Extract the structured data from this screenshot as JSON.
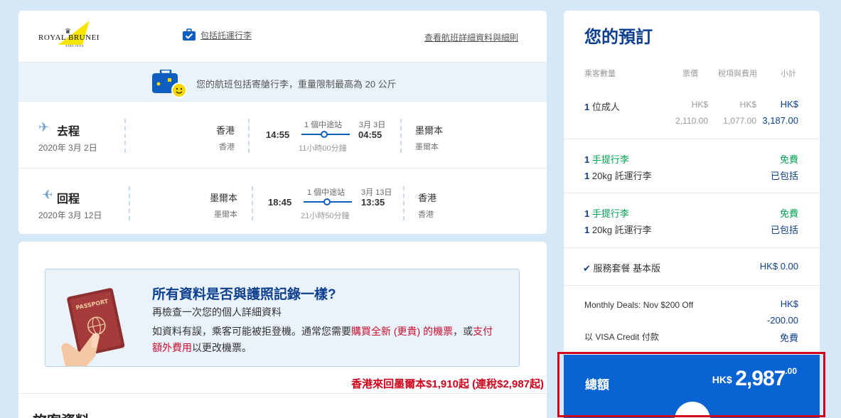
{
  "airline": {
    "name_line1": "ROYAL BRUNEI",
    "name_line2": "AIRLINES"
  },
  "flight_links": {
    "baggage_included": "包括託運行李",
    "details": "查看航班詳細資料與細則"
  },
  "baggage_banner": "您的航班包括寄艙行李，重量限制最高為 20 公斤",
  "outbound": {
    "title": "去程",
    "date": "2020年 3月 2日",
    "from_city": "香港",
    "from_city_sub": "香港",
    "dep_time": "14:55",
    "stops": "1 個中途站",
    "arr_date": "3月 3日",
    "arr_time": "04:55",
    "duration": "11小時00分鐘",
    "to_city": "墨爾本",
    "to_city_sub": "墨爾本"
  },
  "return": {
    "title": "回程",
    "date": "2020年 3月 12日",
    "from_city": "墨爾本",
    "from_city_sub": "墨爾本",
    "dep_time": "18:45",
    "stops": "1 個中途站",
    "arr_date": "3月 13日",
    "arr_time": "13:35",
    "duration": "21小時50分鐘",
    "to_city": "香港",
    "to_city_sub": "香港"
  },
  "passport_notice": {
    "title": "所有資料是否與護照記錄一樣?",
    "subtitle": "再檢查一次您的個人詳細資料",
    "body_1": "如資料有誤，乘客可能被拒登機。通常您需要",
    "body_red_1": "購買全新 (更貴) 的機票",
    "body_2": "，或",
    "body_red_2": "支付額外費用",
    "body_3": "以更改機票。"
  },
  "promo": "香港來回墨爾本$1,910起 (連稅$2,987起)",
  "next_section_title": "旅客資料",
  "booking": {
    "title": "您的預訂",
    "headers": {
      "passengers": "乘客數量",
      "fare": "票價",
      "taxes": "稅項與費用",
      "subtotal": "小計"
    },
    "adult_count": "1",
    "adult_label": "位成人",
    "fare_cur": "HK$",
    "fare_amt": "2,110.00",
    "tax_cur": "HK$",
    "tax_amt": "1,077.00",
    "sub_cur": "HK$",
    "sub_amt": "3,187.00",
    "bag_groups": [
      {
        "hand_count": "1",
        "hand_label": "手提行李",
        "hand_value": "免費",
        "checked_count": "1",
        "checked_label": "20kg 託運行李",
        "checked_value": "已包括"
      },
      {
        "hand_count": "1",
        "hand_label": "手提行李",
        "hand_value": "免費",
        "checked_count": "1",
        "checked_label": "20kg 託運行李",
        "checked_value": "已包括"
      }
    ],
    "service_label": "服務套餐 基本版",
    "service_value": "HK$ 0.00",
    "deal_label": "Monthly Deals: Nov $200 Off",
    "deal_cur": "HK$",
    "deal_value": "-200.00",
    "payment_label": "以 VISA Credit 付款",
    "payment_value": "免費",
    "total_label": "總額",
    "total_cur": "HK$",
    "total_main": "2,987",
    "total_cents": ".00"
  },
  "colors": {
    "navy": "#0d3f8f",
    "blue": "#0a63d2",
    "green": "#00a050",
    "red": "#d0021b"
  }
}
